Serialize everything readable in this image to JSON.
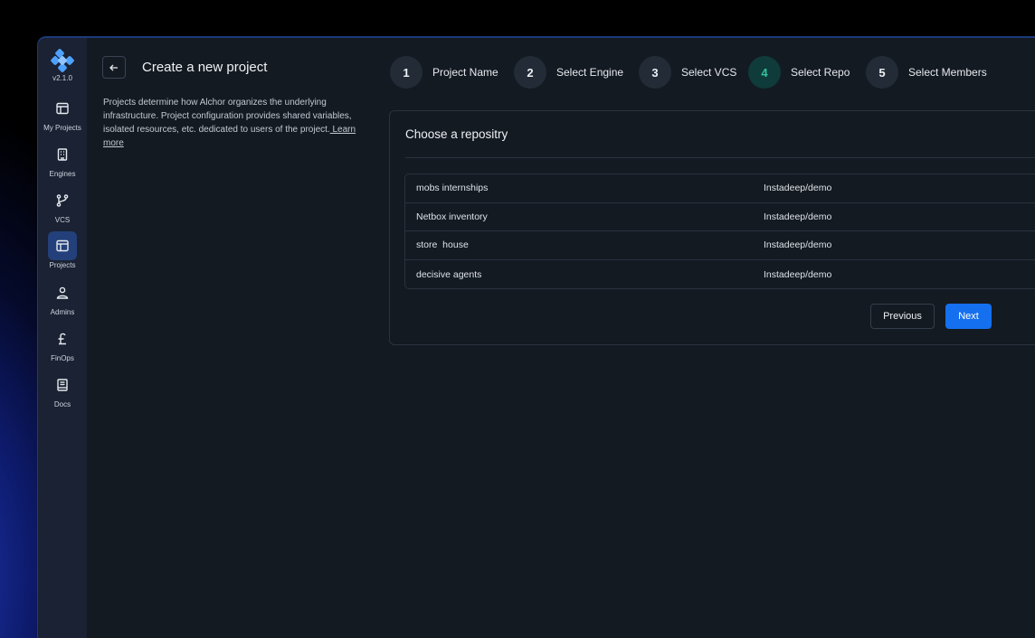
{
  "app": {
    "version": "v2.1.0"
  },
  "sidebar": {
    "items": [
      {
        "label": "My Projects",
        "icon": "layout-icon"
      },
      {
        "label": "Engines",
        "icon": "building-icon"
      },
      {
        "label": "VCS",
        "icon": "git-branch-icon"
      },
      {
        "label": "Projects",
        "icon": "layout-icon",
        "active": true
      },
      {
        "label": "Admins",
        "icon": "user-gear-icon"
      },
      {
        "label": "FinOps",
        "icon": "pound-icon"
      },
      {
        "label": "Docs",
        "icon": "book-icon"
      }
    ]
  },
  "header": {
    "title": "Create a new project",
    "description": "Projects determine how Alchor organizes the underlying infrastructure.  Project configuration provides shared variables, isolated resources,  etc. dedicated to users of the project.",
    "learn_more": " Learn more"
  },
  "steps": [
    {
      "number": "1",
      "label": "Project Name"
    },
    {
      "number": "2",
      "label": "Select Engine"
    },
    {
      "number": "3",
      "label": "Select VCS"
    },
    {
      "number": "4",
      "label": "Select Repo",
      "active": true
    },
    {
      "number": "5",
      "label": "Select Members"
    }
  ],
  "card": {
    "title": "Choose a repositry",
    "repos": [
      {
        "name": "mobs internships",
        "owner": "Instadeep/demo"
      },
      {
        "name": "Netbox inventory",
        "owner": "Instadeep/demo"
      },
      {
        "name": "store  house",
        "owner": "Instadeep/demo"
      },
      {
        "name": "decisive agents",
        "owner": "Instadeep/demo"
      }
    ],
    "previous_label": "Previous",
    "next_label": "Next"
  },
  "colors": {
    "accent": "#1570ef",
    "active_step": "#2ec5a0",
    "sidebar_bg": "#1a2233",
    "main_bg": "#141a22"
  }
}
